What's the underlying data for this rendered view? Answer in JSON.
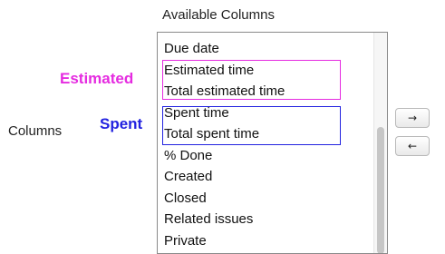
{
  "available_columns": {
    "title": "Available Columns",
    "items": [
      "Due date",
      "Estimated time",
      "Total estimated time",
      "Spent time",
      "Total spent time",
      "% Done",
      "Created",
      "Closed",
      "Related issues",
      "Private"
    ]
  },
  "columns_label": "Columns",
  "annotations": {
    "estimated": {
      "label": "Estimated",
      "color": "#e52be0"
    },
    "spent": {
      "label": "Spent",
      "color": "#2222e0"
    }
  },
  "buttons": {
    "move_right": {
      "icon": "right-arrow-icon",
      "glyph": "→"
    },
    "move_left": {
      "icon": "left-arrow-icon",
      "glyph": "←"
    }
  }
}
